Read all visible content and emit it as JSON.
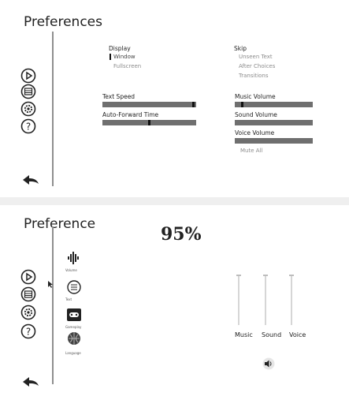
{
  "top": {
    "title": "Preferences",
    "display": {
      "heading": "Display",
      "options": [
        "Window",
        "Fullscreen"
      ],
      "selected": "Window"
    },
    "skip": {
      "heading": "Skip",
      "options": [
        "Unseen Text",
        "After Choices",
        "Transitions"
      ]
    },
    "text_speed": {
      "label": "Text Speed",
      "value": 0.98
    },
    "auto_forward": {
      "label": "Auto-Forward Time",
      "value": 0.5
    },
    "music_volume": {
      "label": "Music Volume",
      "value": 0.08
    },
    "sound_volume": {
      "label": "Sound Volume"
    },
    "voice_volume": {
      "label": "Voice Volume"
    },
    "mute_all": "Mute All"
  },
  "bottom": {
    "title": "Preference",
    "percent": "95%",
    "categories": [
      "Volume",
      "Text",
      "Gameplay",
      "Language"
    ],
    "sliders": [
      "Music",
      "Sound",
      "Voice"
    ]
  },
  "icons": [
    "play-icon",
    "save-icon",
    "gear-icon",
    "help-icon",
    "back-arrow-icon",
    "volume-icon",
    "text-icon",
    "gamepad-icon",
    "language-icon",
    "speaker-icon"
  ],
  "colors": {
    "bar": "#6f6f6f",
    "thumb": "#111111",
    "muted_text": "#8c8c8c"
  }
}
